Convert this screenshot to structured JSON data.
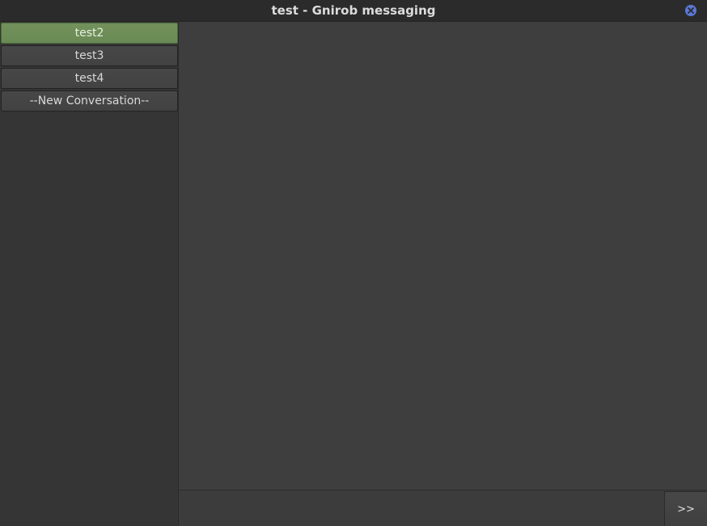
{
  "window": {
    "title": "test - Gnirob messaging"
  },
  "sidebar": {
    "conversations": [
      {
        "label": "test2",
        "active": true
      },
      {
        "label": "test3",
        "active": false
      },
      {
        "label": "test4",
        "active": false
      },
      {
        "label": "--New Conversation--",
        "active": false
      }
    ]
  },
  "composer": {
    "input_value": "",
    "send_label": ">>"
  },
  "colors": {
    "active_conversation": "#6a8a55",
    "close_button": "#5a78d6",
    "background": "#3e3e3e"
  },
  "icons": {
    "close": "close-icon"
  }
}
